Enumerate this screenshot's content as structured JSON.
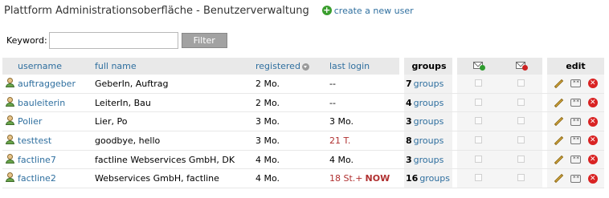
{
  "header": {
    "title": "Plattform Administrationsoberfläche - Benutzerverwaltung",
    "create_link": "create a new user"
  },
  "filter": {
    "keyword_label": "Keyword:",
    "keyword_value": "",
    "button_label": "Filter"
  },
  "table": {
    "headers": {
      "username": "username",
      "fullname": "full name",
      "registered": "registered",
      "last_login": "last login",
      "groups": "groups",
      "edit": "edit"
    },
    "groups_word": "groups",
    "pw_icon_text": "**",
    "rows": [
      {
        "username": "auftraggeber",
        "fullname": "GeberIn, Auftrag",
        "registered": "2 Mo.",
        "last_login": "--",
        "last_login_recent": false,
        "now": "",
        "groups_count": "7"
      },
      {
        "username": "bauleiterin",
        "fullname": "LeiterIn, Bau",
        "registered": "2 Mo.",
        "last_login": "--",
        "last_login_recent": false,
        "now": "",
        "groups_count": "4"
      },
      {
        "username": "Polier",
        "fullname": "Lier, Po",
        "registered": "3 Mo.",
        "last_login": "3 Mo.",
        "last_login_recent": false,
        "now": "",
        "groups_count": "3"
      },
      {
        "username": "testtest",
        "fullname": "goodbye, hello",
        "registered": "3 Mo.",
        "last_login": "21 T.",
        "last_login_recent": true,
        "now": "",
        "groups_count": "8"
      },
      {
        "username": "factline7",
        "fullname": "factline Webservices GmbH, DK",
        "registered": "4 Mo.",
        "last_login": "4 Mo.",
        "last_login_recent": false,
        "now": "",
        "groups_count": "3"
      },
      {
        "username": "factline2",
        "fullname": "Webservices GmbH, factline",
        "registered": "4 Mo.",
        "last_login": "18 St.+",
        "last_login_recent": true,
        "now": "NOW",
        "groups_count": "16"
      }
    ]
  }
}
